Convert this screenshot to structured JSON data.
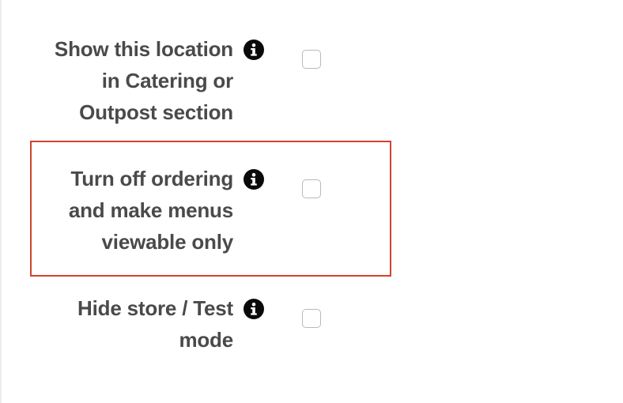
{
  "settings": [
    {
      "label_lines": [
        "Show this location",
        "in Catering or",
        "Outpost section"
      ],
      "info_icon": "info-circle-icon",
      "checked": false,
      "highlighted": false
    },
    {
      "label_lines": [
        "Turn off ordering",
        "and make menus",
        "viewable only"
      ],
      "info_icon": "info-circle-icon",
      "checked": false,
      "highlighted": true
    },
    {
      "label_lines": [
        "Hide store / Test",
        "mode"
      ],
      "info_icon": "info-circle-icon",
      "checked": false,
      "highlighted": false
    }
  ],
  "colors": {
    "label_text": "#4a4a4a",
    "info_icon_bg": "#0a0a0a",
    "checkbox_border": "#b9b9b9",
    "highlight_border": "#d0432f"
  }
}
